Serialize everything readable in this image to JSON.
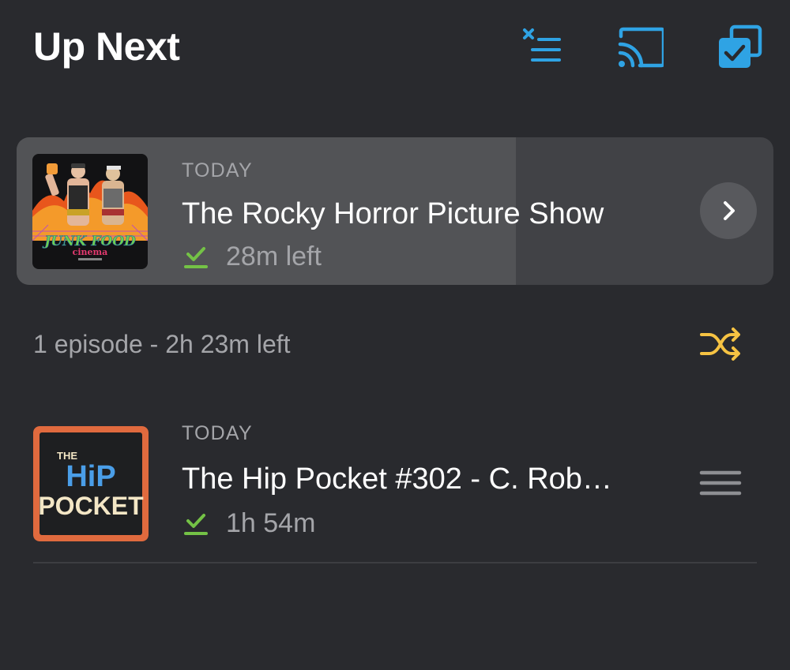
{
  "header": {
    "title": "Up Next",
    "icons": [
      "clear-queue-icon",
      "cast-icon",
      "multi-select-icon"
    ],
    "accent_color": "#2fa3e4"
  },
  "now_playing": {
    "date": "TODAY",
    "title": "The Rocky Horror Picture Show",
    "time_left": "28m left",
    "progress": 0.66,
    "artwork": {
      "name": "junk-food-cinema-artwork",
      "line1": "JUNK FOOD",
      "line2": "cinema"
    }
  },
  "queue_summary": {
    "text": "1 episode - 2h 23m left",
    "shuffle_color": "#f6c343"
  },
  "queue": [
    {
      "date": "TODAY",
      "title": "The Hip Pocket #302 - C. Rob…",
      "duration": "1h 54m",
      "artwork": {
        "name": "hip-pocket-artwork",
        "line1": "THE",
        "line2": "HiP",
        "line3": "POCKET"
      }
    }
  ],
  "colors": {
    "background": "#292a2e",
    "download_check": "#74c246",
    "secondary_text": "#a4a5a9"
  }
}
